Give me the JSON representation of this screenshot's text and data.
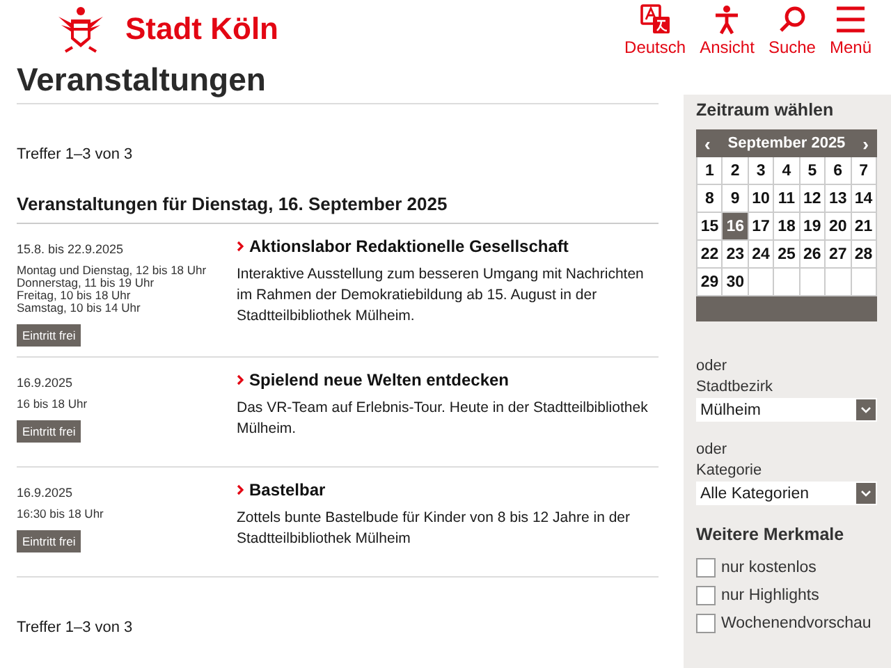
{
  "header": {
    "logo_text": "Stadt Köln",
    "nav": [
      {
        "kind": "language",
        "label": "Deutsch"
      },
      {
        "kind": "view",
        "label": "Ansicht"
      },
      {
        "kind": "search",
        "label": "Suche"
      },
      {
        "kind": "menu",
        "label": "Menü"
      }
    ]
  },
  "page_title": "Veranstaltungen",
  "results_top": "Treffer 1–3 von 3",
  "day_heading": "Veranstaltungen für Dienstag, 16. September 2025",
  "events": [
    {
      "date": "15.8. bis 22.9.2025",
      "times": [
        "Montag und Dienstag, 12 bis 18 Uhr",
        "Donnerstag, 11 bis 19 Uhr",
        "Freitag, 10 bis 18 Uhr",
        "Samstag, 10 bis 14 Uhr"
      ],
      "badge": "Eintritt frei",
      "title": "Aktionslabor Redaktionelle Gesellschaft",
      "description": "Interaktive Ausstellung zum besseren Umgang mit Nachrichten im Rahmen der Demokratiebildung ab 15. August in der Stadtteilbibliothek Mülheim."
    },
    {
      "date": "16.9.2025",
      "times": [
        "16 bis 18 Uhr"
      ],
      "badge": "Eintritt frei",
      "title": "Spielend neue Welten entdecken",
      "description": "Das VR-Team auf Erlebnis-Tour. Heute in der Stadtteilbibliothek Mülheim."
    },
    {
      "date": "16.9.2025",
      "times": [
        "16:30 bis 18 Uhr"
      ],
      "badge": "Eintritt frei",
      "title": "Bastelbar",
      "description": "Zottels bunte Bastelbude für Kinder von 8 bis 12 Jahre in der Stadtteilbibliothek Mülheim"
    }
  ],
  "results_bottom": "Treffer 1–3 von 3",
  "sidebar": {
    "period_heading": "Zeitraum wählen",
    "calendar": {
      "prev": "‹",
      "month": "September 2025",
      "next": "›",
      "days": [
        {
          "label": "1",
          "selected": false
        },
        {
          "label": "2",
          "selected": false
        },
        {
          "label": "3",
          "selected": false
        },
        {
          "label": "4",
          "selected": false
        },
        {
          "label": "5",
          "selected": false
        },
        {
          "label": "6",
          "selected": false
        },
        {
          "label": "7",
          "selected": false
        },
        {
          "label": "8",
          "selected": false
        },
        {
          "label": "9",
          "selected": false
        },
        {
          "label": "10",
          "selected": false
        },
        {
          "label": "11",
          "selected": false
        },
        {
          "label": "12",
          "selected": false
        },
        {
          "label": "13",
          "selected": false
        },
        {
          "label": "14",
          "selected": false
        },
        {
          "label": "15",
          "selected": false
        },
        {
          "label": "16",
          "selected": true
        },
        {
          "label": "17",
          "selected": false
        },
        {
          "label": "18",
          "selected": false
        },
        {
          "label": "19",
          "selected": false
        },
        {
          "label": "20",
          "selected": false
        },
        {
          "label": "21",
          "selected": false
        },
        {
          "label": "22",
          "selected": false
        },
        {
          "label": "23",
          "selected": false
        },
        {
          "label": "24",
          "selected": false
        },
        {
          "label": "25",
          "selected": false
        },
        {
          "label": "26",
          "selected": false
        },
        {
          "label": "27",
          "selected": false
        },
        {
          "label": "28",
          "selected": false
        },
        {
          "label": "29",
          "selected": false
        },
        {
          "label": "30",
          "selected": false
        }
      ]
    },
    "filters": [
      {
        "or": "oder",
        "label": "Stadtbezirk",
        "value": "Mülheim"
      },
      {
        "or": "oder",
        "label": "Kategorie",
        "value": "Alle Kategorien"
      }
    ],
    "features_heading": "Weitere Merkmale",
    "features": [
      {
        "label": "nur kostenlos",
        "checked": false
      },
      {
        "label": "nur Highlights",
        "checked": false
      },
      {
        "label": "Wochenendvorschau",
        "checked": false
      }
    ]
  }
}
